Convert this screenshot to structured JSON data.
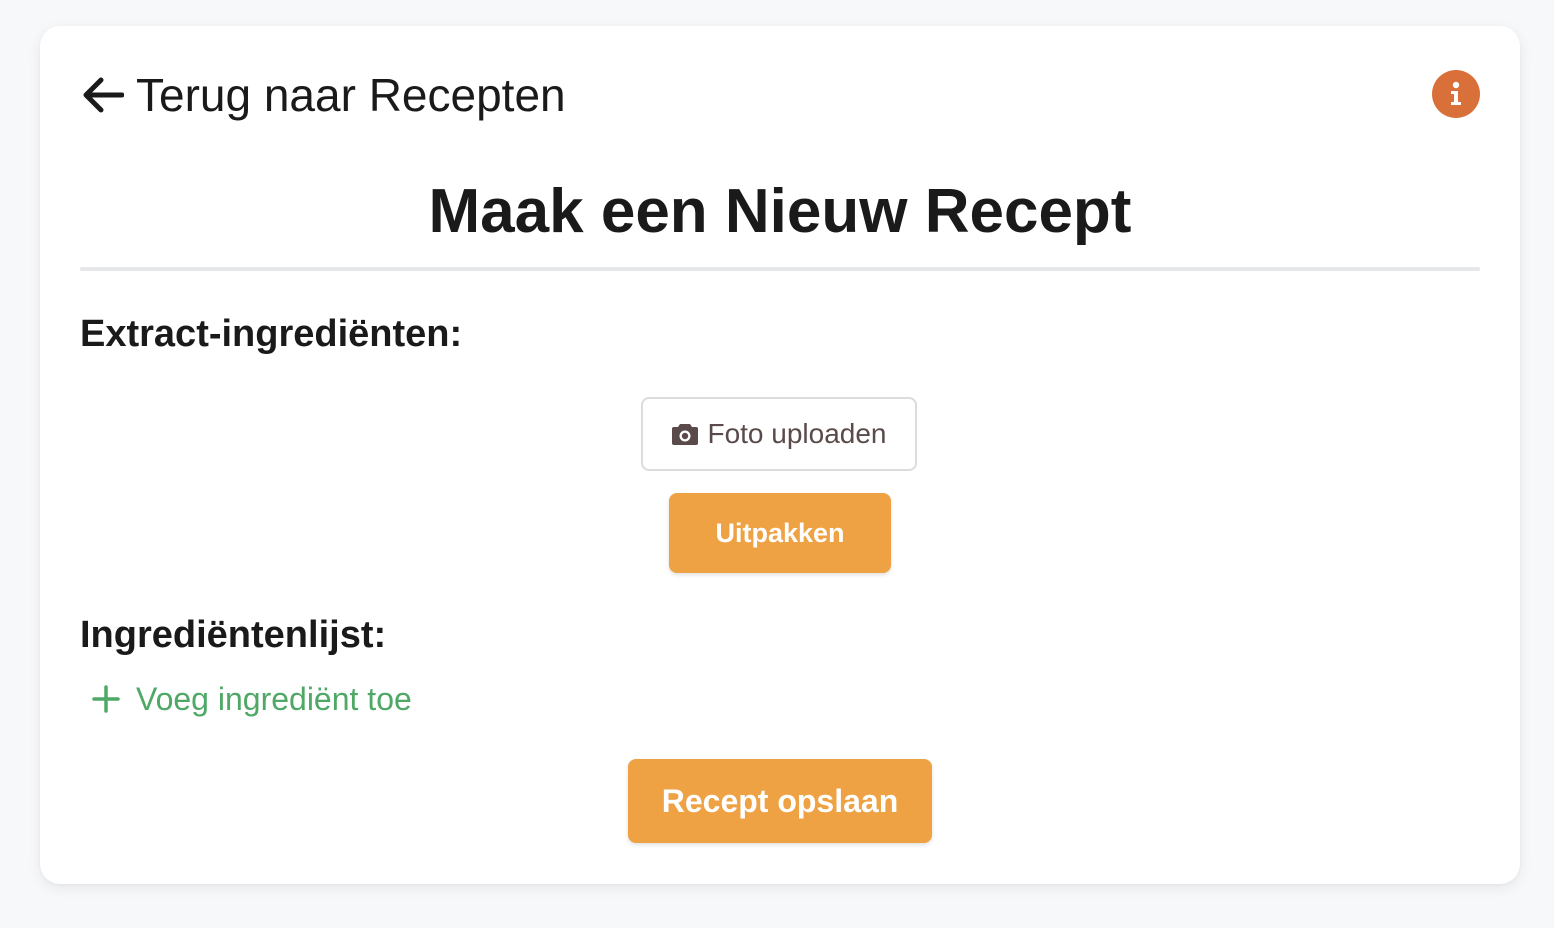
{
  "header": {
    "back_label": "Terug naar Recepten",
    "back_icon": "arrow-left-icon",
    "info_icon": "info-icon"
  },
  "page": {
    "title": "Maak een Nieuw Recept"
  },
  "extract": {
    "heading": "Extract-ingrediënten:",
    "upload_label": "Foto uploaden",
    "upload_icon": "camera-icon",
    "extract_button": "Uitpakken"
  },
  "ingredients": {
    "heading": "Ingrediëntenlijst:",
    "add_label": "Voeg ingrediënt toe",
    "add_icon": "plus-icon"
  },
  "actions": {
    "save_label": "Recept opslaan"
  },
  "colors": {
    "accent": "#eea244",
    "info": "#d9703a",
    "add_link": "#4fa866",
    "background": "#f7f8fa",
    "card": "#ffffff"
  }
}
